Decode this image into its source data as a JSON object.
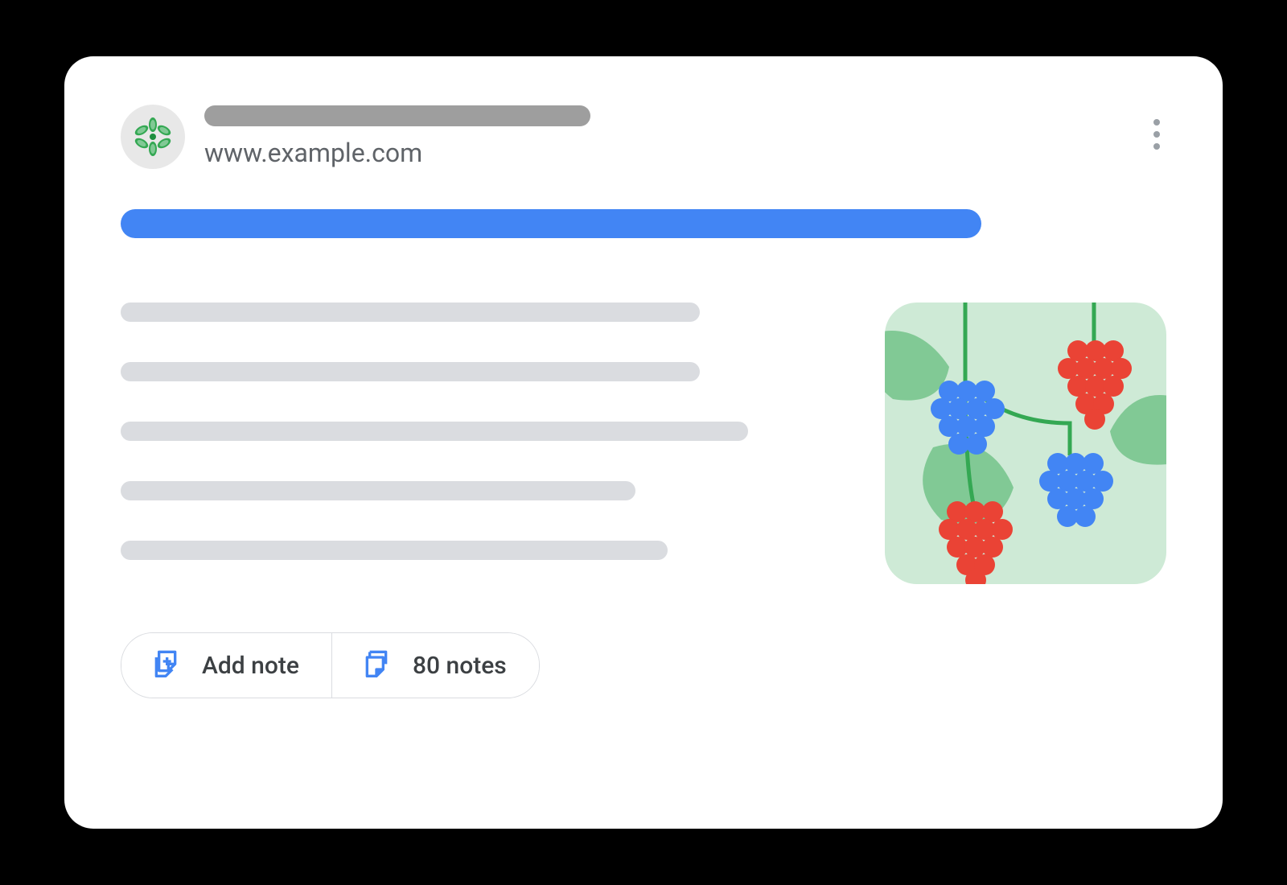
{
  "header": {
    "url": "www.example.com"
  },
  "actions": {
    "add_note_label": "Add note",
    "notes_count_label": "80 notes"
  }
}
